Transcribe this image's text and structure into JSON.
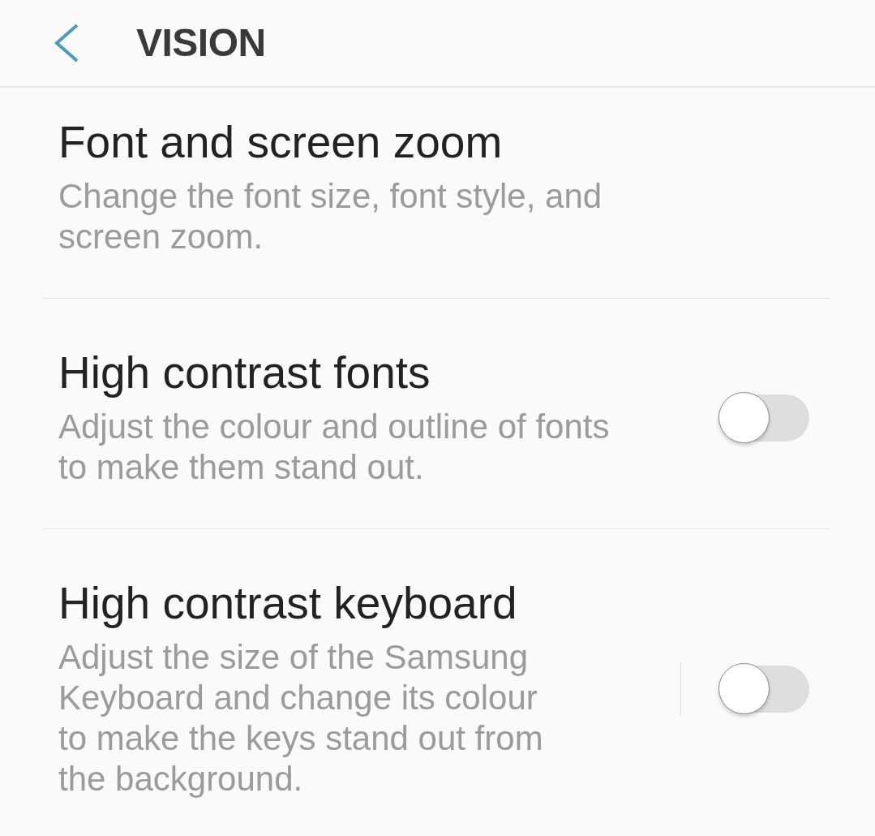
{
  "header": {
    "title": "VISION"
  },
  "items": [
    {
      "kind": "link",
      "title": "Font and screen zoom",
      "description": "Change the font size, font style, and screen zoom."
    },
    {
      "kind": "switch",
      "title": "High contrast fonts",
      "description": "Adjust the colour and outline of fonts to make them stand out.",
      "on": false
    },
    {
      "kind": "split_switch",
      "title": "High contrast keyboard",
      "description": "Adjust the size of the Samsung Keyboard and change its colour to make the keys stand out from the background.",
      "on": false
    }
  ]
}
